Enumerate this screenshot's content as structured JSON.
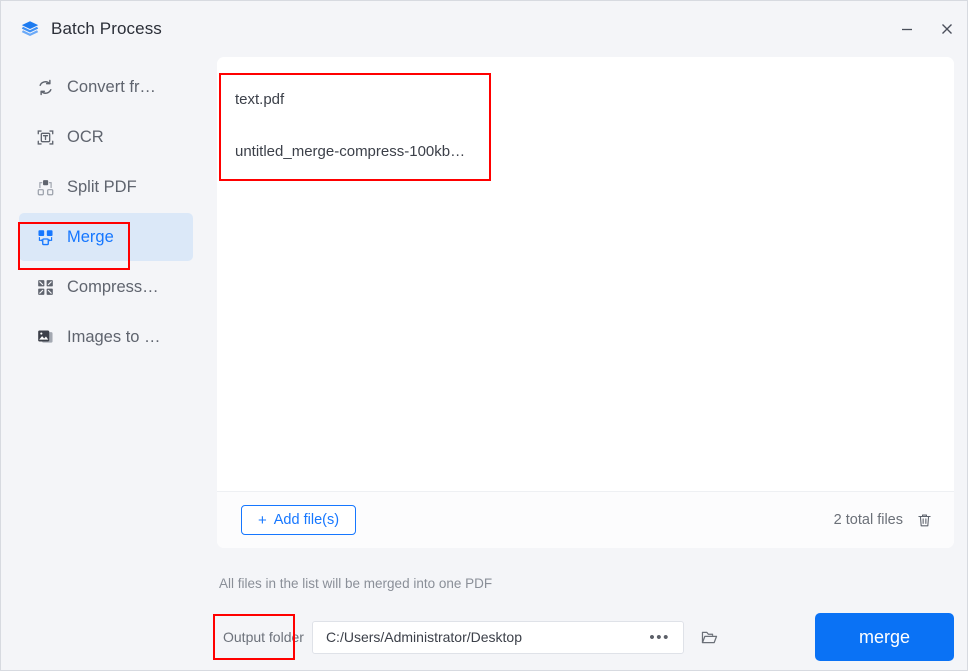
{
  "window": {
    "title": "Batch Process",
    "app_icon": "layers-stack-icon",
    "minimize_label": "–",
    "close_label": "×",
    "accent_color": "#1677ff",
    "merge_button_color": "#0a72f5",
    "annotation_color": "#ff0000",
    "active_item_bg": "#dbe8f8"
  },
  "sidebar": {
    "items": [
      {
        "id": "convert-from",
        "label": "Convert fr…",
        "icon": "convert-arrows-icon",
        "active": false
      },
      {
        "id": "ocr",
        "label": "OCR",
        "icon": "ocr-text-frame-icon",
        "active": false
      },
      {
        "id": "split-pdf",
        "label": "Split PDF",
        "icon": "split-squares-icon",
        "active": false
      },
      {
        "id": "merge",
        "label": "Merge",
        "icon": "merge-squares-icon",
        "active": true
      },
      {
        "id": "compress",
        "label": "Compress…",
        "icon": "compress-squares-icon",
        "active": false
      },
      {
        "id": "images-to-pdf",
        "label": "Images to …",
        "icon": "images-picture-icon",
        "active": false
      }
    ]
  },
  "file_list": {
    "files": [
      {
        "name": "text.pdf"
      },
      {
        "name": "untitled_merge-compress-100kb…"
      }
    ]
  },
  "card_footer": {
    "add_button": {
      "plus": "+",
      "label": "Add file(s)"
    },
    "total_files_text": "2 total files",
    "delete_icon": "trash-icon"
  },
  "bottom": {
    "hint": "All files in the list will be merged into one PDF",
    "output_label": "Output folder",
    "output_path": "C:/Users/Administrator/Desktop",
    "output_path_placeholder": "Select output folder",
    "ellipsis_label": "•••",
    "browse_icon": "folder-open-icon",
    "merge_button_label": "merge"
  }
}
